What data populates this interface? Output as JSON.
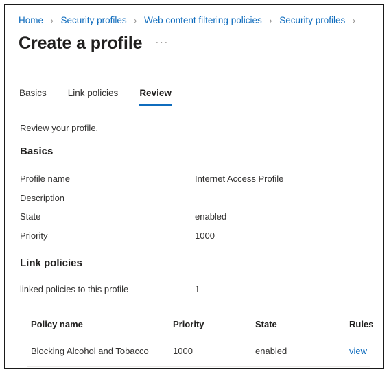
{
  "breadcrumb": {
    "separator": "›",
    "items": [
      {
        "label": "Home"
      },
      {
        "label": "Security profiles"
      },
      {
        "label": "Web content filtering policies"
      },
      {
        "label": "Security profiles"
      }
    ],
    "trailing_separator": "›"
  },
  "header": {
    "title": "Create a profile",
    "more_menu": "···"
  },
  "tabs": [
    {
      "label": "Basics",
      "active": false
    },
    {
      "label": "Link policies",
      "active": false
    },
    {
      "label": "Review",
      "active": true
    }
  ],
  "review": {
    "note": "Review your profile.",
    "basics_heading": "Basics",
    "basics_rows": [
      {
        "key": "Profile name",
        "value": "Internet Access Profile"
      },
      {
        "key": "Description",
        "value": ""
      },
      {
        "key": "State",
        "value": "enabled"
      },
      {
        "key": "Priority",
        "value": "1000"
      }
    ],
    "link_policies_heading": "Link policies",
    "linked_count_label": "linked policies to this profile",
    "linked_count_value": "1",
    "table": {
      "columns": [
        "Policy name",
        "Priority",
        "State",
        "Rules"
      ],
      "rows": [
        {
          "policy_name": "Blocking Alcohol and Tobacco",
          "priority": "1000",
          "state": "enabled",
          "rules": "view"
        }
      ]
    }
  },
  "colors": {
    "link": "#0f6cbd",
    "accent_underline": "#0f6cbd",
    "text": "#323130",
    "heading": "#201f1e",
    "divider": "#edebe9",
    "frame": "#1a1a1a"
  }
}
